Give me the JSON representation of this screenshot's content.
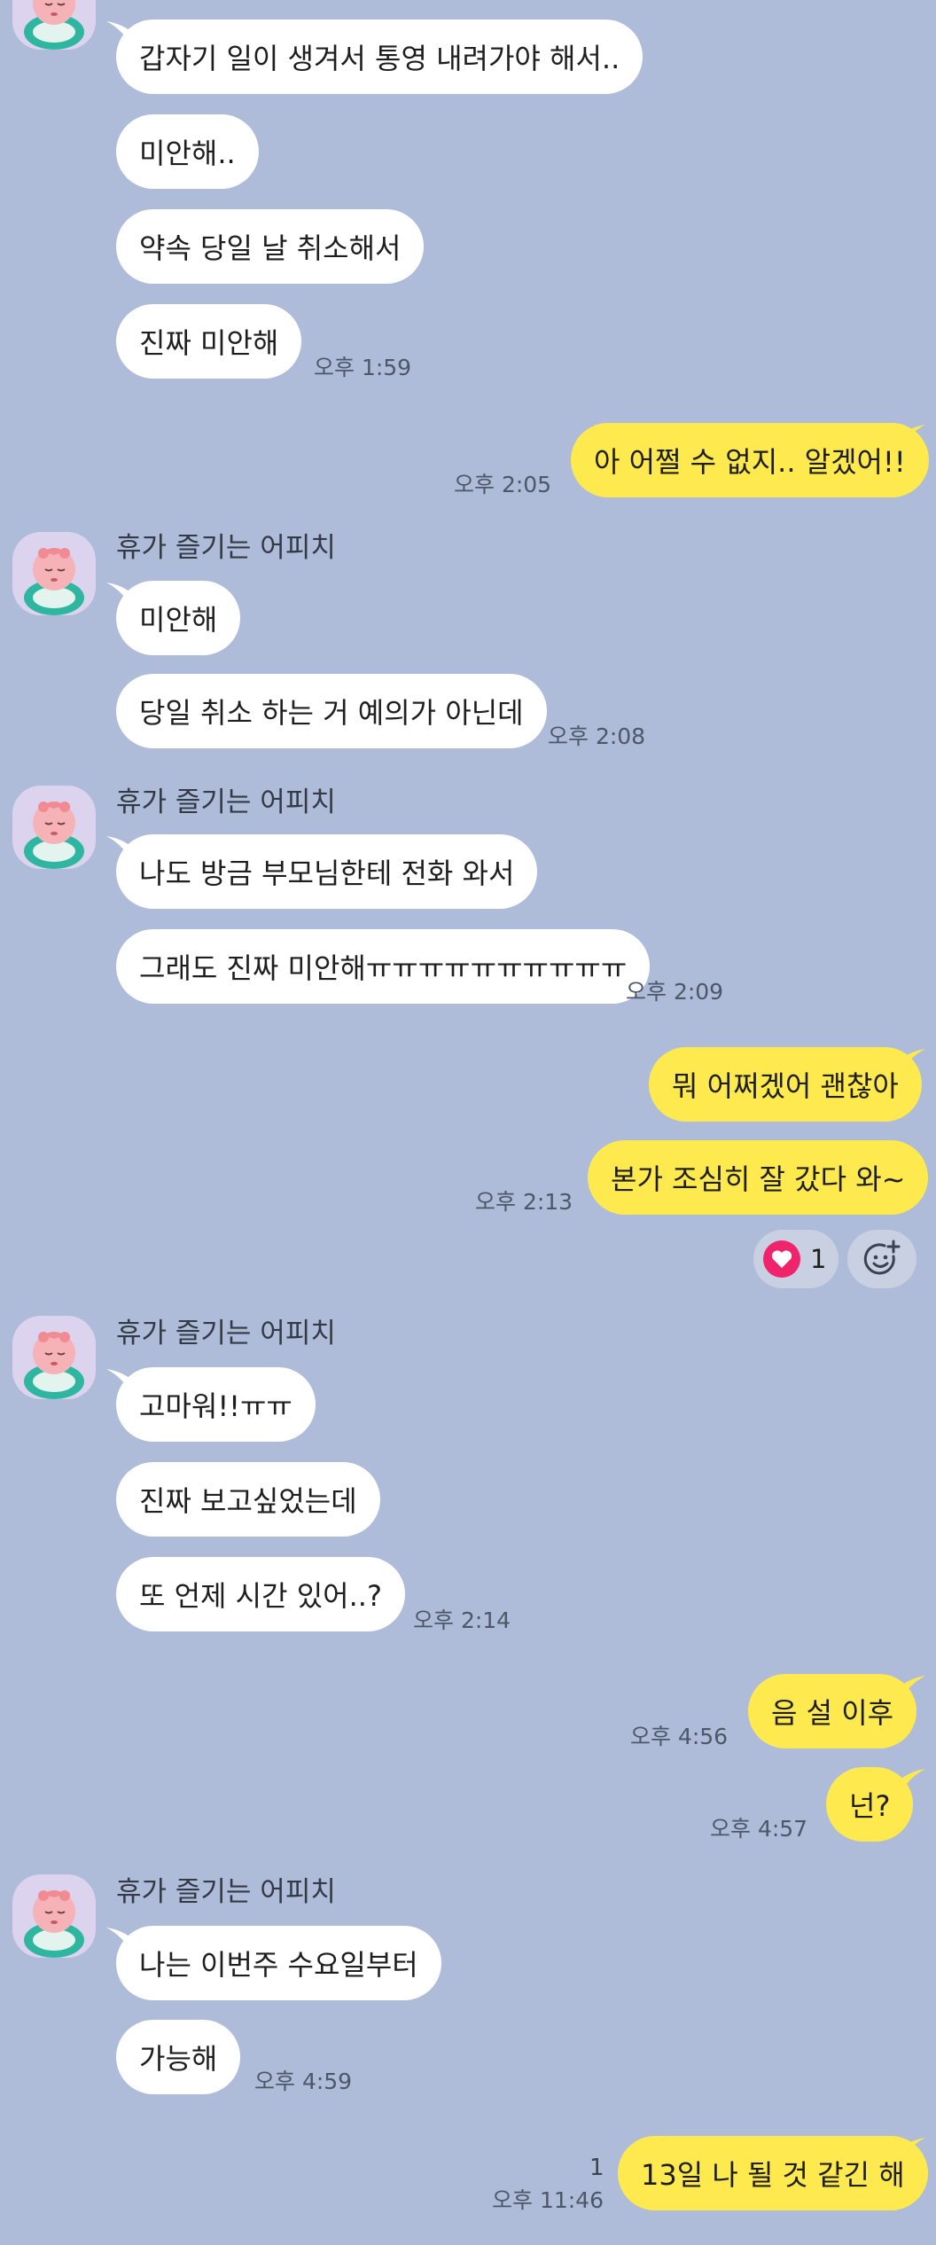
{
  "sender_name": "휴가 즐기는 어피치",
  "messages": [
    {
      "text": "갑자기 일이 생겨서 통영 내려가야 해서.."
    },
    {
      "text": "미안해.."
    },
    {
      "text": "약속 당일 날 취소해서"
    },
    {
      "text": "진짜 미안해",
      "time": "오후 1:59"
    },
    {
      "text": "아 어쩔 수 없지.. 알겠어!!",
      "time": "오후 2:05"
    },
    {
      "text": "미안해"
    },
    {
      "text": "당일 취소 하는 거 예의가 아닌데",
      "time": "오후 2:08"
    },
    {
      "text": "나도 방금 부모님한테 전화 와서"
    },
    {
      "text": "그래도 진짜 미안해ㅠㅠㅠㅠㅠㅠㅠㅠㅠㅠ",
      "time": "오후 2:09"
    },
    {
      "text": "뭐 어쩌겠어 괜찮아"
    },
    {
      "text": "본가 조심히 잘 갔다 와~",
      "time": "오후 2:13"
    },
    {
      "text": "고마워!!ㅠㅠ"
    },
    {
      "text": "진짜 보고싶었는데"
    },
    {
      "text": "또 언제 시간 있어..?",
      "time": "오후 2:14"
    },
    {
      "text": "음 설 이후",
      "time": "오후 4:56"
    },
    {
      "text": "넌?",
      "time": "오후 4:57"
    },
    {
      "text": "나는 이번주 수요일부터"
    },
    {
      "text": "가능해",
      "time": "오후 4:59"
    },
    {
      "text": "13일 나 될 것 같긴 해",
      "time": "오후 11:46",
      "unread": "1"
    }
  ],
  "reaction": {
    "icon": "heart-icon",
    "count": "1"
  },
  "colors": {
    "background": "#AEBCD9",
    "incoming_bubble": "#FFFFFF",
    "outgoing_bubble": "#FEE94F",
    "heart": "#F0246C"
  }
}
